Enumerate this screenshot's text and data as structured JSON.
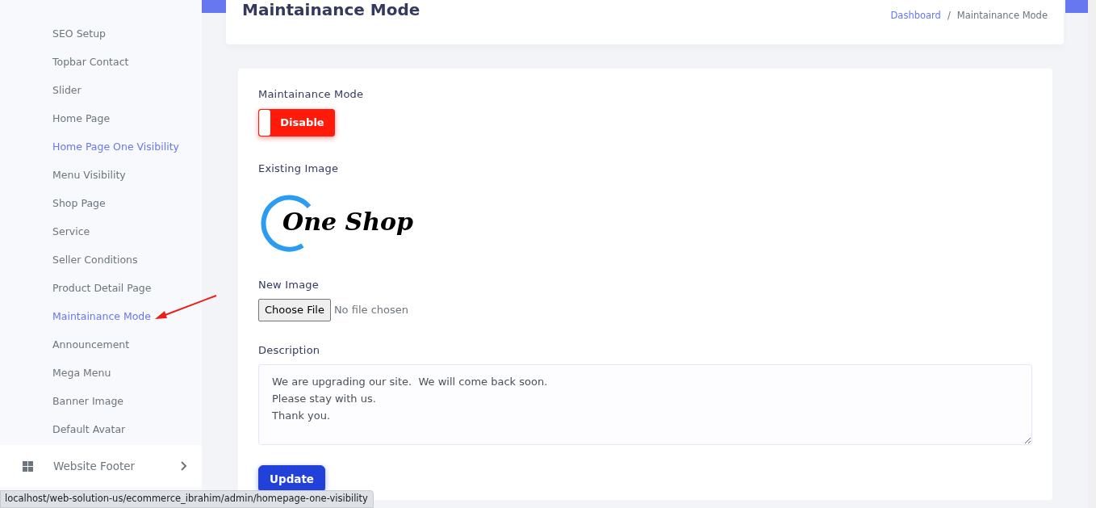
{
  "sidebar": {
    "items": [
      {
        "label": "SEO Setup",
        "selected": false
      },
      {
        "label": "Topbar Contact",
        "selected": false
      },
      {
        "label": "Slider",
        "selected": false
      },
      {
        "label": "Home Page",
        "selected": false
      },
      {
        "label": "Home Page One Visibility",
        "selected": true
      },
      {
        "label": "Menu Visibility",
        "selected": false
      },
      {
        "label": "Shop Page",
        "selected": false
      },
      {
        "label": "Service",
        "selected": false
      },
      {
        "label": "Seller Conditions",
        "selected": false
      },
      {
        "label": "Product Detail Page",
        "selected": false
      },
      {
        "label": "Maintainance Mode",
        "selected": true
      },
      {
        "label": "Announcement",
        "selected": false
      },
      {
        "label": "Mega Menu",
        "selected": false
      },
      {
        "label": "Banner Image",
        "selected": false
      },
      {
        "label": "Default Avatar",
        "selected": false
      }
    ],
    "section": {
      "label": "Website Footer",
      "expanded": false
    }
  },
  "header": {
    "title": "Maintainance Mode",
    "breadcrumb": [
      {
        "label": "Dashboard",
        "kind": "link"
      },
      {
        "label": "/",
        "kind": "separator"
      },
      {
        "label": "Maintainance Mode",
        "kind": "current"
      }
    ]
  },
  "form": {
    "mode_label": "Maintainance Mode",
    "toggle": {
      "label": "Disable",
      "on": false
    },
    "existing_image_label": "Existing Image",
    "logo_text": "One Shop",
    "new_image_label": "New Image",
    "file_button": "Choose File",
    "file_status": "No file chosen",
    "description_label": "Description",
    "description": "We are upgrading our site.  We will come back soon.\nPlease stay with us.\nThank you.",
    "submit": "Update"
  },
  "status_bar": {
    "url": "localhost/web-solution-us/ecommerce_ibrahim/admin/homepage-one-visibility"
  }
}
